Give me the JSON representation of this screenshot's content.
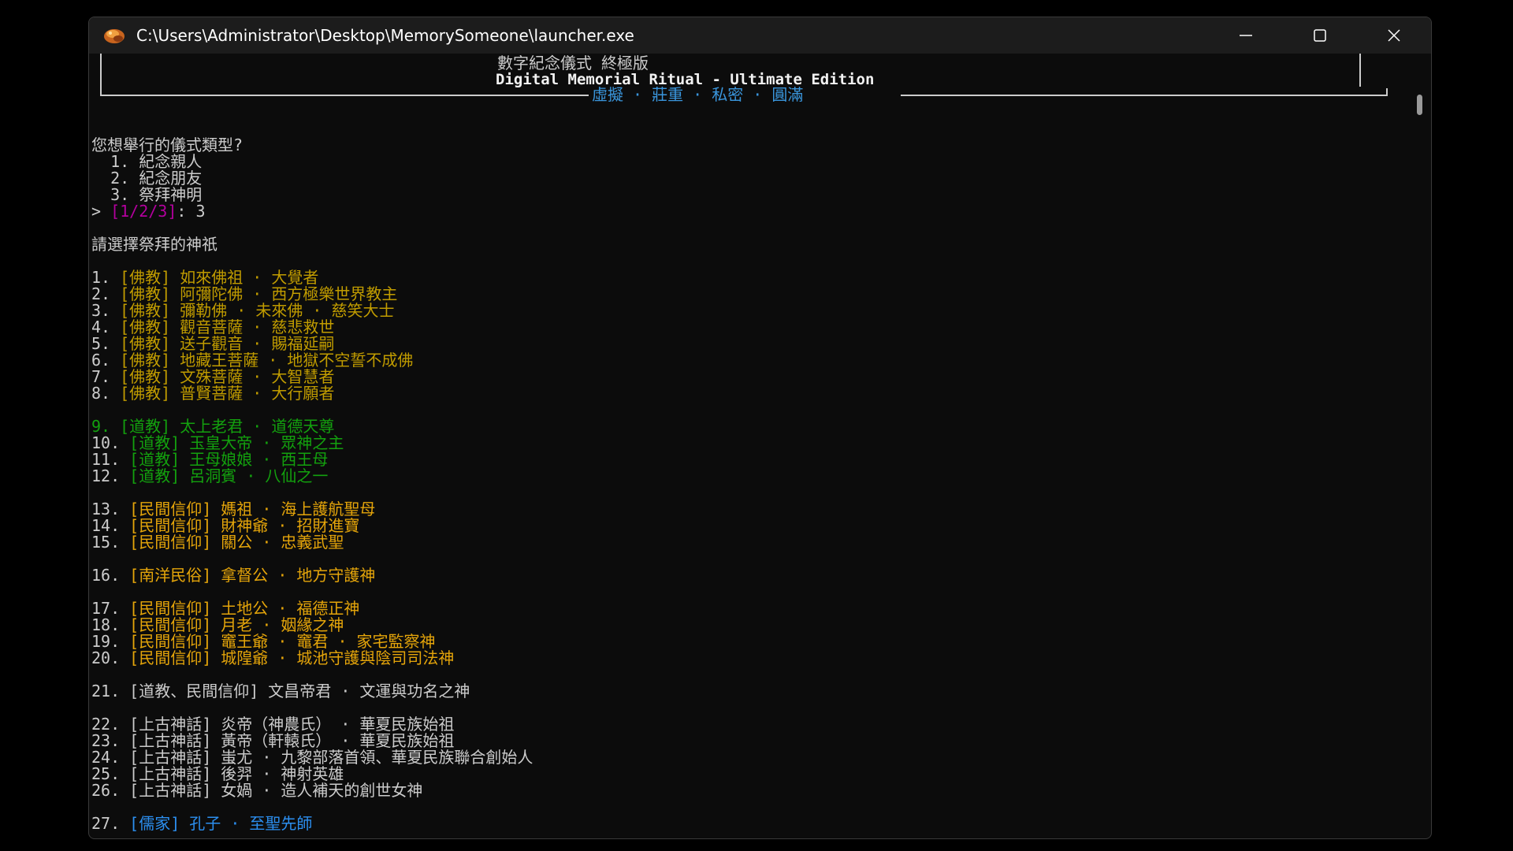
{
  "window": {
    "title": "C:\\Users\\Administrator\\Desktop\\MemorySomeone\\launcher.exe"
  },
  "header": {
    "title_zh": "數字紀念儀式 終極版",
    "title_en": "Digital Memorial Ritual - Ultimate Edition",
    "subtitle": "虛擬 · 莊重 · 私密 · 圓滿"
  },
  "prompt1": {
    "question": "您想舉行的儀式類型?",
    "options": [
      "  1. 紀念親人",
      "  2. 紀念朋友",
      "  3. 祭拜神明"
    ],
    "input_prefix": "> ",
    "choices": "[1/2/3]",
    "input_suffix": ": 3"
  },
  "prompt2": {
    "question": "請選擇祭拜的神祇"
  },
  "deities": [
    {
      "num": "1. ",
      "text": "[佛教] 如來佛祖 · 大覺者"
    },
    {
      "num": "2. ",
      "text": "[佛教] 阿彌陀佛 · 西方極樂世界教主"
    },
    {
      "num": "3. ",
      "text": "[佛教] 彌勒佛 · 未來佛 · 慈笑大士"
    },
    {
      "num": "4. ",
      "text": "[佛教] 觀音菩薩 · 慈悲救世"
    },
    {
      "num": "5. ",
      "text": "[佛教] 送子觀音 · 賜福延嗣"
    },
    {
      "num": "6. ",
      "text": "[佛教] 地藏王菩薩 · 地獄不空誓不成佛"
    },
    {
      "num": "7. ",
      "text": "[佛教] 文殊菩薩 · 大智慧者"
    },
    {
      "num": "8. ",
      "text": "[佛教] 普賢菩薩 · 大行願者"
    },
    {
      "num": "9. ",
      "text": "[道教] 太上老君 · 道德天尊"
    },
    {
      "num": "10. ",
      "text": "[道教] 玉皇大帝 · 眾神之主"
    },
    {
      "num": "11. ",
      "text": "[道教] 王母娘娘 · 西王母"
    },
    {
      "num": "12. ",
      "text": "[道教] 呂洞賓 · 八仙之一"
    },
    {
      "num": "13. ",
      "text": "[民間信仰] 媽祖 · 海上護航聖母"
    },
    {
      "num": "14. ",
      "text": "[民間信仰] 財神爺 · 招財進寶"
    },
    {
      "num": "15. ",
      "text": "[民間信仰] 關公 · 忠義武聖"
    },
    {
      "num": "16. ",
      "text": "[南洋民俗] 拿督公 · 地方守護神"
    },
    {
      "num": "17. ",
      "text": "[民間信仰] 土地公 · 福德正神"
    },
    {
      "num": "18. ",
      "text": "[民間信仰] 月老 · 姻緣之神"
    },
    {
      "num": "19. ",
      "text": "[民間信仰] 竈王爺 · 竈君 · 家宅監察神"
    },
    {
      "num": "20. ",
      "text": "[民間信仰] 城隍爺 · 城池守護與陰司司法神"
    },
    {
      "num": "21. ",
      "text": "[道教、民間信仰] 文昌帝君 · 文運與功名之神"
    },
    {
      "num": "22. ",
      "text": "[上古神話] 炎帝（神農氏） · 華夏民族始祖"
    },
    {
      "num": "23. ",
      "text": "[上古神話] 黃帝（軒轅氏） · 華夏民族始祖"
    },
    {
      "num": "24. ",
      "text": "[上古神話] 蚩尤 · 九黎部落首領、華夏民族聯合創始人"
    },
    {
      "num": "25. ",
      "text": "[上古神話] 後羿 · 神射英雄"
    },
    {
      "num": "26. ",
      "text": "[上古神話] 女媧 · 造人補天的創世女神"
    },
    {
      "num": "27. ",
      "text": "[儒家] 孔子 · 至聖先師"
    }
  ],
  "colors": {
    "buddhist": "#c19c00",
    "taoist": "#13a10e",
    "folk": "#e5a50a",
    "myth": "#cccccc",
    "confucian": "#2c8ff0",
    "prompt_choices": "#b4009e",
    "subtitle": "#3a96dd"
  }
}
